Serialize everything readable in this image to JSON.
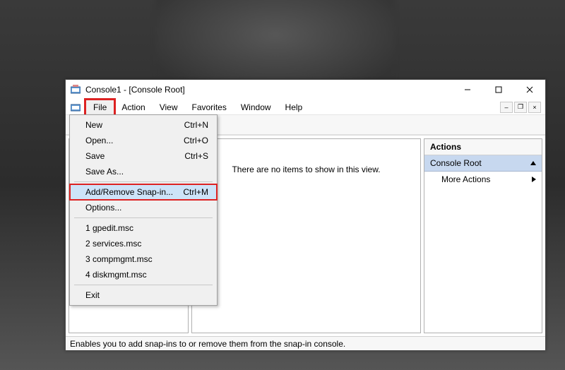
{
  "window": {
    "title": "Console1 - [Console Root]"
  },
  "menubar": {
    "items": [
      "File",
      "Action",
      "View",
      "Favorites",
      "Window",
      "Help"
    ]
  },
  "file_menu": {
    "new": {
      "label": "New",
      "shortcut": "Ctrl+N"
    },
    "open": {
      "label": "Open...",
      "shortcut": "Ctrl+O"
    },
    "save": {
      "label": "Save",
      "shortcut": "Ctrl+S"
    },
    "save_as": {
      "label": "Save As..."
    },
    "add_remove": {
      "label": "Add/Remove Snap-in...",
      "shortcut": "Ctrl+M"
    },
    "options": {
      "label": "Options..."
    },
    "recent": [
      "1 gpedit.msc",
      "2 services.msc",
      "3 compmgmt.msc",
      "4 diskmgmt.msc"
    ],
    "exit": {
      "label": "Exit"
    }
  },
  "center": {
    "empty_text": "There are no items to show in this view."
  },
  "actions": {
    "header": "Actions",
    "root": "Console Root",
    "more": "More Actions"
  },
  "statusbar": {
    "text": "Enables you to add snap-ins to or remove them from the snap-in console."
  }
}
